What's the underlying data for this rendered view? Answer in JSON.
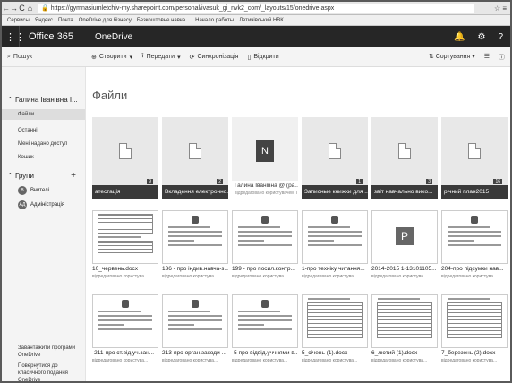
{
  "browser": {
    "back": "←",
    "forward": "→",
    "reload": "C",
    "home": "⌂",
    "url": "https://gymnasiumletchiv-my.sharepoint.com/personal/ivasuk_gi_nvk2_com/_layouts/15/onedrive.aspx",
    "bookmarks": [
      "Сервисы",
      "Яндекс",
      "Почта",
      "OneDrive для бізнесу",
      "Безкоштовне навча...",
      "Начало работы",
      "Летичівський НВК ..."
    ]
  },
  "suite": {
    "app_launcher_icon": "waffle-icon",
    "brand": "Office 365",
    "app": "OneDrive",
    "icons": [
      "bell-icon",
      "gear-icon",
      "help-icon"
    ]
  },
  "command_bar": {
    "search": "Пошук",
    "create": "Створити",
    "upload": "Передати",
    "sync": "Синхронізація",
    "open": "Відкрити",
    "sort": "Сортування",
    "view_icon": "list-view-icon",
    "info_icon": "info-icon"
  },
  "sidebar": {
    "owner": "Галина Іванівна І...",
    "items": [
      "Файли",
      "Останні",
      "Мені надано доступ",
      "Кошик"
    ],
    "groups_label": "Групи",
    "groups": [
      {
        "initials": "В",
        "name": "Вчителі"
      },
      {
        "initials": "АД",
        "name": "Адміністрація"
      }
    ],
    "footer1": "Завантажити програми OneDrive",
    "footer2": "Повернутися до класичного подання OneDrive"
  },
  "main": {
    "title": "Файли",
    "folders": [
      {
        "name": "атестація",
        "count": "9"
      },
      {
        "name": "Вкладення електронно...",
        "count": "2"
      },
      {
        "name": "Галина Іванівна @ (ра...",
        "sub": "відредаговано користувачем Т...",
        "notebook": true
      },
      {
        "name": "Записные книжки для ...",
        "count": "1"
      },
      {
        "name": "звіт навчально вихо...",
        "count": "3"
      },
      {
        "name": "річний план2015",
        "count": "16"
      }
    ],
    "files_row1": [
      {
        "name": "10_червень.docx",
        "sub": "відредаговано користува..."
      },
      {
        "name": "136 - про індив.навча-з...",
        "sub": "відредаговано користува..."
      },
      {
        "name": "199 - про посил.контр...",
        "sub": "відредаговано користува..."
      },
      {
        "name": "1-про техніку читання...",
        "sub": "відредаговано користува..."
      },
      {
        "name": "2014-2015 1-13101105...",
        "sub": "відредаговано користува..."
      },
      {
        "name": "204-про підсумки нав...",
        "sub": "відредаговано користува..."
      }
    ],
    "files_row2": [
      {
        "name": "-211-про ст.від.уч.зан...",
        "sub": "відредаговано користува..."
      },
      {
        "name": "213-про орган.заходи ...",
        "sub": "відредаговано користува..."
      },
      {
        "name": "-5 про відвід.уччнями в...",
        "sub": "відредаговано користува..."
      },
      {
        "name": "5_січень (1).docx",
        "sub": "відредаговано користува..."
      },
      {
        "name": "6_лютий (1).docx",
        "sub": "відредаговано користува..."
      },
      {
        "name": "7_березень (2).docx",
        "sub": "відредаговано користува..."
      }
    ]
  }
}
